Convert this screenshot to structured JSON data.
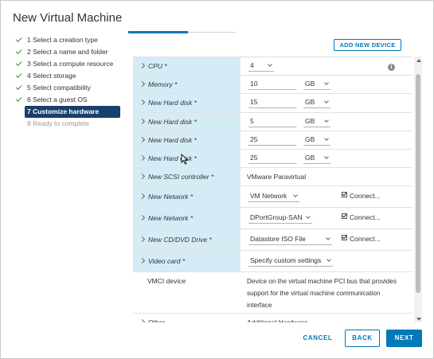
{
  "dialog": {
    "title": "New Virtual Machine"
  },
  "steps": [
    {
      "label": "1 Select a creation type",
      "state": "done"
    },
    {
      "label": "2 Select a name and folder",
      "state": "done"
    },
    {
      "label": "3 Select a compute resource",
      "state": "done"
    },
    {
      "label": "4 Select storage",
      "state": "done"
    },
    {
      "label": "5 Select compatibility",
      "state": "done"
    },
    {
      "label": "6 Select a guest OS",
      "state": "done"
    },
    {
      "label": "7 Customize hardware",
      "state": "active"
    },
    {
      "label": "8 Ready to complete",
      "state": "disabled"
    }
  ],
  "toolbar": {
    "add_device_label": "ADD NEW DEVICE"
  },
  "hardware": {
    "cpu": {
      "label": "CPU *",
      "value": "4"
    },
    "memory": {
      "label": "Memory *",
      "value": "10",
      "unit": "GB"
    },
    "disks": [
      {
        "label": "New Hard disk *",
        "value": "15",
        "unit": "GB"
      },
      {
        "label": "New Hard disk *",
        "value": "5",
        "unit": "GB"
      },
      {
        "label": "New Hard disk *",
        "value": "25",
        "unit": "GB"
      },
      {
        "label": "New Hard disk *",
        "value": "25",
        "unit": "GB"
      }
    ],
    "scsi": {
      "label": "New SCSI controller *",
      "value": "VMware Paravirtual"
    },
    "networks": [
      {
        "label": "New Network *",
        "value": "VM Network",
        "connect": "Connect..."
      },
      {
        "label": "New Network *",
        "value": "DPortGroup-SAN",
        "connect": "Connect..."
      }
    ],
    "cdrom": {
      "label": "New CD/DVD Drive *",
      "value": "Datastore ISO File",
      "connect": "Connect..."
    },
    "video": {
      "label": "Video card *",
      "value": "Specify custom settings"
    },
    "vmci": {
      "label": "VMCI device",
      "description": "Device on the virtual machine PCI bus that provides support for the virtual machine communication interface"
    },
    "other": {
      "label": "Other",
      "value": "Additional Hardware"
    }
  },
  "footer": {
    "cancel_label": "CANCEL",
    "back_label": "BACK",
    "next_label": "NEXT"
  },
  "icons": {
    "info": "info-icon",
    "check": "check-icon",
    "chevron": "chevron-right-icon",
    "caret": "chevron-down-icon"
  },
  "colors": {
    "accent": "#0079b8",
    "active_step": "#17406d",
    "row_highlight": "#d5ecf7",
    "check": "#3c8a2e"
  }
}
